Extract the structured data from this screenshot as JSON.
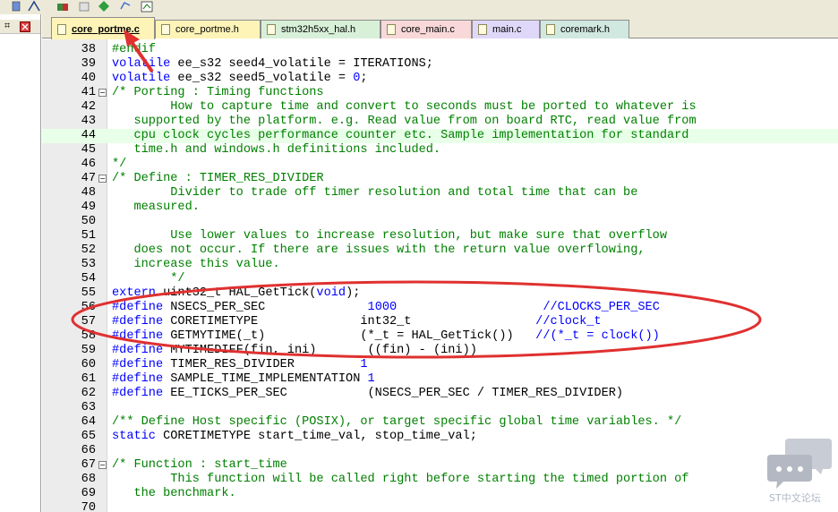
{
  "toolbar": {
    "icons": [
      "debug-icon",
      "build-icon",
      "copy-icon",
      "settings-icon",
      "edit-icon",
      "grid-icon"
    ]
  },
  "sidepanel": {
    "pin_glyph": "⌗",
    "icons": [
      "pin-icon",
      "close-icon"
    ]
  },
  "tabs": [
    {
      "label": "core_portme.c",
      "color": "#fff4b8",
      "active": true
    },
    {
      "label": "core_portme.h",
      "color": "#fff4b8",
      "active": false
    },
    {
      "label": "stm32h5xx_hal.h",
      "color": "#d8f0d8",
      "active": false
    },
    {
      "label": "core_main.c",
      "color": "#f8d8d8",
      "active": false
    },
    {
      "label": "main.c",
      "color": "#e0d8f8",
      "active": false
    },
    {
      "label": "coremark.h",
      "color": "#d0e8e0",
      "active": false
    }
  ],
  "colors": {
    "comment": "#008000",
    "keyword": "#0000ff",
    "annotation": "#e03030"
  },
  "lines": [
    {
      "n": "38",
      "fold": "",
      "segs": [
        [
          "cm",
          "#endif"
        ]
      ]
    },
    {
      "n": "39",
      "fold": "",
      "segs": [
        [
          "kw",
          "volatile"
        ],
        [
          "tx",
          " ee_s32 seed4_volatile = ITERATIONS;"
        ]
      ]
    },
    {
      "n": "40",
      "fold": "",
      "segs": [
        [
          "kw",
          "volatile"
        ],
        [
          "tx",
          " ee_s32 seed5_volatile = "
        ],
        [
          "num",
          "0"
        ],
        [
          "tx",
          ";"
        ]
      ]
    },
    {
      "n": "41",
      "fold": "minus",
      "segs": [
        [
          "cm",
          "/* Porting : Timing functions"
        ]
      ]
    },
    {
      "n": "42",
      "fold": "",
      "segs": [
        [
          "cm",
          "        How to capture time and convert to seconds must be ported to whatever is"
        ]
      ]
    },
    {
      "n": "43",
      "fold": "",
      "segs": [
        [
          "cm",
          "   supported by the platform. e.g. Read value from on board RTC, read value from"
        ]
      ]
    },
    {
      "n": "44",
      "fold": "",
      "hl": true,
      "segs": [
        [
          "cm",
          "   cpu clock cycles performance counter etc. Sample implementation for standard"
        ]
      ]
    },
    {
      "n": "45",
      "fold": "",
      "segs": [
        [
          "cm",
          "   time.h and windows.h definitions included."
        ]
      ]
    },
    {
      "n": "46",
      "fold": "end",
      "segs": [
        [
          "cm",
          "*/"
        ]
      ]
    },
    {
      "n": "47",
      "fold": "minus",
      "segs": [
        [
          "cm",
          "/* Define : TIMER_RES_DIVIDER"
        ]
      ]
    },
    {
      "n": "48",
      "fold": "",
      "segs": [
        [
          "cm",
          "        Divider to trade off timer resolution and total time that can be"
        ]
      ]
    },
    {
      "n": "49",
      "fold": "",
      "segs": [
        [
          "cm",
          "   measured."
        ]
      ]
    },
    {
      "n": "50",
      "fold": "",
      "segs": [
        [
          "cm",
          ""
        ]
      ]
    },
    {
      "n": "51",
      "fold": "",
      "segs": [
        [
          "cm",
          "        Use lower values to increase resolution, but make sure that overflow"
        ]
      ]
    },
    {
      "n": "52",
      "fold": "",
      "segs": [
        [
          "cm",
          "   does not occur. If there are issues with the return value overflowing,"
        ]
      ]
    },
    {
      "n": "53",
      "fold": "",
      "segs": [
        [
          "cm",
          "   increase this value."
        ]
      ]
    },
    {
      "n": "54",
      "fold": "end",
      "segs": [
        [
          "cm",
          "        */"
        ]
      ]
    },
    {
      "n": "55",
      "fold": "",
      "segs": [
        [
          "kw",
          "extern"
        ],
        [
          "tx",
          " uint32_t HAL_GetTick("
        ],
        [
          "kw",
          "void"
        ],
        [
          "tx",
          ");"
        ]
      ]
    },
    {
      "n": "56",
      "fold": "",
      "segs": [
        [
          "pp",
          "#define"
        ],
        [
          "tx",
          " NSECS_PER_SEC              "
        ],
        [
          "num",
          "1000"
        ],
        [
          "tx",
          "                    "
        ],
        [
          "cmb",
          "//CLOCKS_PER_SEC"
        ]
      ]
    },
    {
      "n": "57",
      "fold": "",
      "segs": [
        [
          "pp",
          "#define"
        ],
        [
          "tx",
          " CORETIMETYPE              int32_t                 "
        ],
        [
          "cmb",
          "//clock_t"
        ]
      ]
    },
    {
      "n": "58",
      "fold": "",
      "segs": [
        [
          "pp",
          "#define"
        ],
        [
          "tx",
          " GETMYTIME(_t)             (*_t = HAL_GetTick())   "
        ],
        [
          "cmb",
          "//(*_t = clock())"
        ]
      ]
    },
    {
      "n": "59",
      "fold": "",
      "segs": [
        [
          "pp",
          "#define"
        ],
        [
          "tx",
          " MYTIMEDIFF(fin, ini)       ((fin) - (ini))"
        ]
      ]
    },
    {
      "n": "60",
      "fold": "",
      "segs": [
        [
          "pp",
          "#define"
        ],
        [
          "tx",
          " TIMER_RES_DIVIDER         "
        ],
        [
          "num",
          "1"
        ]
      ]
    },
    {
      "n": "61",
      "fold": "",
      "segs": [
        [
          "pp",
          "#define"
        ],
        [
          "tx",
          " SAMPLE_TIME_IMPLEMENTATION "
        ],
        [
          "num",
          "1"
        ]
      ]
    },
    {
      "n": "62",
      "fold": "",
      "segs": [
        [
          "pp",
          "#define"
        ],
        [
          "tx",
          " EE_TICKS_PER_SEC           (NSECS_PER_SEC / TIMER_RES_DIVIDER)"
        ]
      ]
    },
    {
      "n": "63",
      "fold": "",
      "segs": [
        [
          "tx",
          ""
        ]
      ]
    },
    {
      "n": "64",
      "fold": "",
      "segs": [
        [
          "cm",
          "/** Define Host specific (POSIX), or target specific global time variables. */"
        ]
      ]
    },
    {
      "n": "65",
      "fold": "",
      "segs": [
        [
          "kw",
          "static"
        ],
        [
          "tx",
          " CORETIMETYPE start_time_val, stop_time_val;"
        ]
      ]
    },
    {
      "n": "66",
      "fold": "",
      "segs": [
        [
          "tx",
          ""
        ]
      ]
    },
    {
      "n": "67",
      "fold": "minus",
      "segs": [
        [
          "cm",
          "/* Function : start_time"
        ]
      ]
    },
    {
      "n": "68",
      "fold": "",
      "segs": [
        [
          "cm",
          "        This function will be called right before starting the timed portion of"
        ]
      ]
    },
    {
      "n": "69",
      "fold": "",
      "segs": [
        [
          "cm",
          "   the benchmark."
        ]
      ]
    },
    {
      "n": "70",
      "fold": "",
      "segs": [
        [
          "cm",
          ""
        ]
      ]
    }
  ],
  "watermark": {
    "label": "ST中文论坛",
    "icon": "chat-bubble-icon"
  }
}
